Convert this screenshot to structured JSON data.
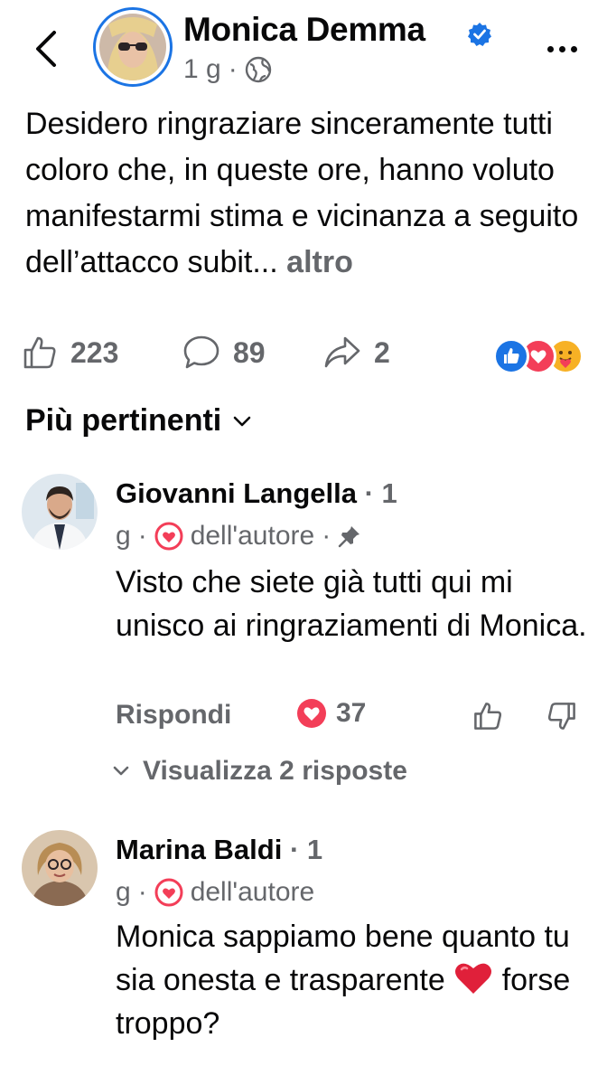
{
  "header": {
    "author_name": "Monica Demma",
    "time": "1 g",
    "separator": "·"
  },
  "post": {
    "text": "Desidero ringraziare sinceramente tutti coloro che, in queste ore, hanno voluto manifestarmi stima e vicinanza a seguito dell’attacco subit...",
    "more_label": "altro",
    "likes": "223",
    "comments": "89",
    "shares": "2"
  },
  "sort": {
    "label": "Più pertinenti"
  },
  "comments": [
    {
      "name": "Giovanni Langella",
      "time_a": "· 1",
      "time_b": "g",
      "sep": "·",
      "badge": "dell'autore",
      "sep2": "·",
      "text": "Visto che siete già tutti qui mi unisco ai ringraziamenti di Monica.",
      "reply_label": "Rispondi",
      "love_count": "37",
      "view_replies": "Visualizza 2 risposte"
    },
    {
      "name": "Marina Baldi",
      "time_a": "· 1",
      "time_b": "g",
      "sep": "·",
      "badge": "dell'autore",
      "text_before": "Monica sappiamo bene quanto tu sia onesta e trasparente",
      "text_after": "forse troppo?"
    }
  ],
  "colors": {
    "accent": "#1b74e4",
    "secondary_text": "#65676b",
    "love": "#f33e58"
  },
  "icons": [
    "back-arrow-icon",
    "globe-icon",
    "verified-badge-icon",
    "more-dots-icon",
    "like-icon",
    "comment-icon",
    "share-icon",
    "chevron-down-icon",
    "heart-icon",
    "pin-icon",
    "thumb-up-icon",
    "thumb-down-icon",
    "red-heart-emoji"
  ]
}
